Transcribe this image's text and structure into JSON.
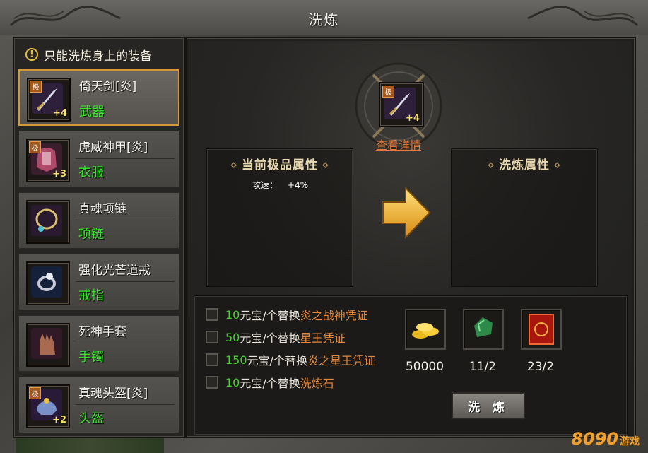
{
  "window": {
    "title": "洗炼"
  },
  "left_panel": {
    "notice_icon": "!",
    "notice": "只能洗炼身上的装备",
    "items": [
      {
        "name": "倚天剑[炎]",
        "type": "武器",
        "grade": "极",
        "plus": "+4",
        "icon": "sword-icon",
        "selected": true
      },
      {
        "name": "虎威神甲[炎]",
        "type": "衣服",
        "grade": "极",
        "plus": "+3",
        "icon": "armor-icon",
        "selected": false
      },
      {
        "name": "真魂项链",
        "type": "项链",
        "grade": "",
        "plus": "",
        "icon": "necklace-icon",
        "selected": false
      },
      {
        "name": "强化光芒道戒",
        "type": "戒指",
        "grade": "",
        "plus": "",
        "icon": "ring-icon",
        "selected": false
      },
      {
        "name": "死神手套",
        "type": "手镯",
        "grade": "",
        "plus": "",
        "icon": "glove-icon",
        "selected": false
      },
      {
        "name": "真魂头盔[炎]",
        "type": "头盔",
        "grade": "极",
        "plus": "+2",
        "icon": "helmet-icon",
        "selected": false
      }
    ]
  },
  "main": {
    "equipped": {
      "grade": "极",
      "plus": "+4",
      "icon": "sword-icon"
    },
    "detail_link": "查看详情",
    "current_attr_title": "当前极品属性",
    "current_attrs": [
      {
        "label": "攻速：",
        "value": "+4%"
      }
    ],
    "refine_attr_title": "洗炼属性",
    "options": [
      {
        "cost": "10",
        "unit": "元宝/个替换",
        "target": "炎之战神凭证"
      },
      {
        "cost": "50",
        "unit": "元宝/个替换",
        "target": "星王凭证"
      },
      {
        "cost": "150",
        "unit": "元宝/个替换",
        "target": "炎之星王凭证"
      },
      {
        "cost": "10",
        "unit": "元宝/个替换",
        "target": "洗炼石"
      }
    ],
    "resources": [
      {
        "icon": "gold-coins-icon",
        "count": "50000"
      },
      {
        "icon": "green-stone-icon",
        "count": "11/2"
      },
      {
        "icon": "red-card-icon",
        "count": "23/2"
      }
    ],
    "refine_button": "洗 炼"
  },
  "watermark": {
    "brand": "8090",
    "suffix": "游戏"
  },
  "colors": {
    "accent_green": "#36e82a",
    "accent_orange": "#e7893a",
    "selected_border": "#d49a3a"
  }
}
